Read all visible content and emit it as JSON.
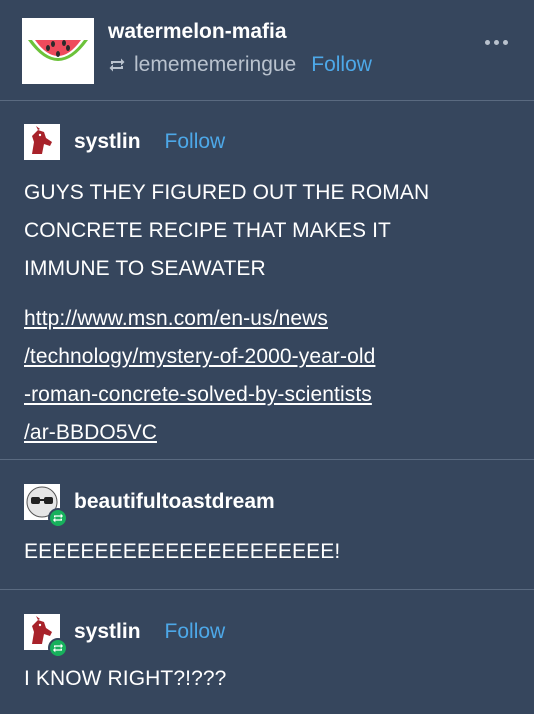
{
  "header": {
    "blog_name": "watermelon-mafia",
    "reblogged_from": "lemememeringue",
    "follow_label": "Follow"
  },
  "posts": [
    {
      "username": "systlin",
      "follow_label": "Follow",
      "text_lines": [
        "GUYS THEY FIGURED OUT THE ROMAN",
        "CONCRETE RECIPE THAT MAKES IT",
        "IMMUNE TO SEAWATER"
      ],
      "link_lines": [
        "http://www.msn.com/en-us/news",
        "/technology/mystery-of-2000-year-old",
        "-roman-concrete-solved-by-scientists",
        "/ar-BBDO5VC"
      ]
    },
    {
      "username": "beautifultoastdream",
      "text": "EEEEEEEEEEEEEEEEEEEEEE!"
    },
    {
      "username": "systlin",
      "follow_label": "Follow",
      "text": "I KNOW RIGHT?!???"
    }
  ],
  "colors": {
    "background": "#36465d",
    "follow": "#4da8e8",
    "muted": "#b9c2ce",
    "reblog_badge": "#17b05c"
  },
  "icons": [
    "watermelon-avatar-icon",
    "reblog-icon",
    "more-options-icon",
    "horse-avatar-icon",
    "sunglasses-avatar-icon",
    "reblog-badge-icon"
  ]
}
